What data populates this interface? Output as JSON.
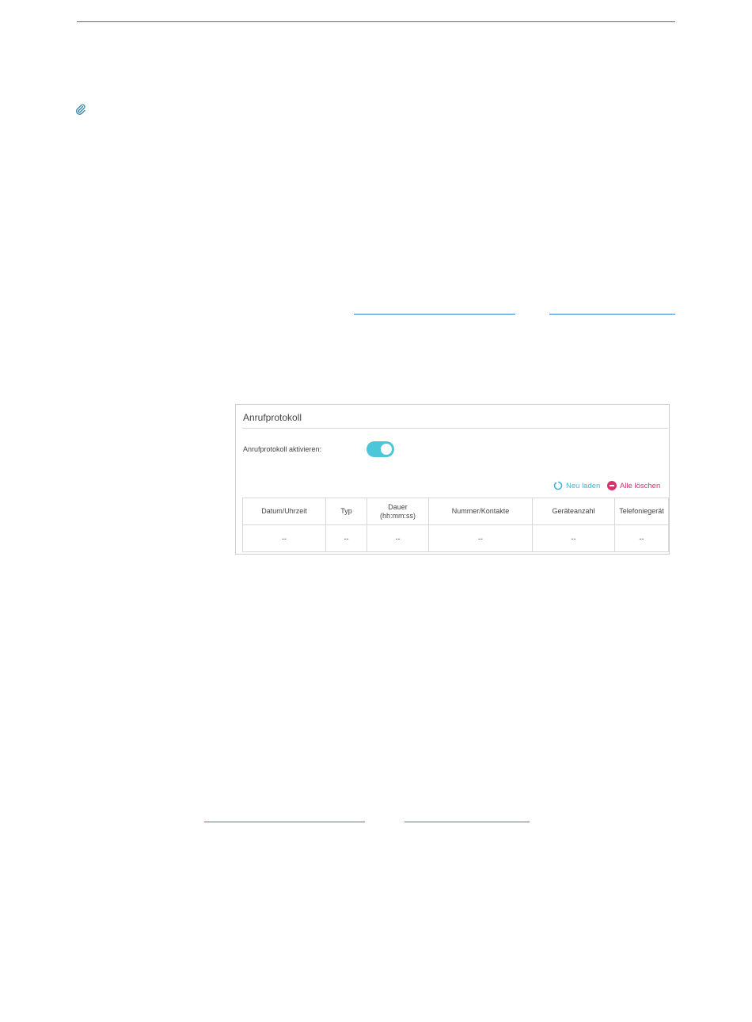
{
  "panel": {
    "title": "Anrufprotokoll",
    "toggle_label": "Anrufprotokoll aktivieren:",
    "toggle_on": true,
    "toggle_color": "#4cc6d9",
    "actions": {
      "reload_label": "Neu laden",
      "reload_icon": "refresh-icon",
      "reload_color": "#3cb7d4",
      "clear_label": "Alle löschen",
      "clear_icon": "minus-circle-icon",
      "clear_color": "#d7336b"
    },
    "table": {
      "headers": [
        "Datum/Uhrzeit",
        "Typ",
        "Dauer (hh:mm:ss)",
        "Nummer/Kontakte",
        "Geräteanzahl",
        "Telefoniegerät"
      ],
      "rows": [
        [
          "--",
          "--",
          "--",
          "--",
          "--",
          "--"
        ]
      ]
    }
  },
  "colors": {
    "top_rule": "#3c6fa8",
    "link_underline": "#3a7bd5",
    "clip_icon": "#2f7fa0"
  },
  "icons": {
    "note_icon": "paperclip-icon"
  }
}
